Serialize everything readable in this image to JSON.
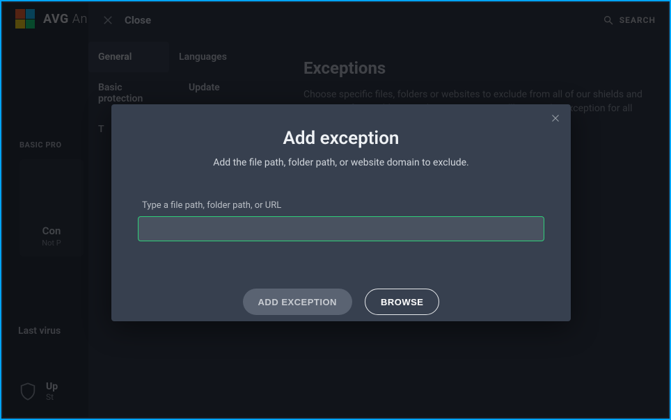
{
  "brand": {
    "bold": "AVG",
    "thin": "An"
  },
  "header": {
    "search_label": "SEARCH",
    "close_label": "Close"
  },
  "nav": {
    "general": "General",
    "languages": "Languages",
    "basic_protection": "Basic protection",
    "update": "Update",
    "t": "T"
  },
  "content": {
    "title": "Exceptions",
    "description": "Choose specific files, folders or websites to exclude from all of our shields and scans. So if you add www.yahoo.com/news, we'll create the exception for all"
  },
  "left": {
    "basic_pro_label": "BASIC PRO",
    "card_title": "Con",
    "card_sub": "Not P",
    "last_virus": "Last virus",
    "upgrade_line1": "Up",
    "upgrade_line2": "St"
  },
  "modal": {
    "title": "Add exception",
    "subtitle": "Add the file path, folder path, or website domain to exclude.",
    "field_label": "Type a file path, folder path, or URL",
    "input_value": "",
    "add_button": "ADD EXCEPTION",
    "browse_button": "BROWSE"
  }
}
